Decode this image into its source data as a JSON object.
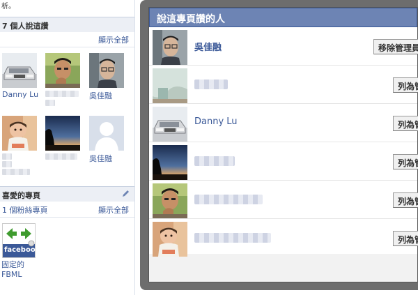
{
  "sidebar": {
    "top_text": "析。",
    "likes_section": {
      "title": "7 個人說這讚",
      "show_all": "顯示全部",
      "friends": [
        {
          "name": "Danny Lu",
          "photo": "car"
        },
        {
          "name": "",
          "photo": "man-hand"
        },
        {
          "name": "吳佳融",
          "photo": "man-glasses"
        },
        {
          "name": "",
          "photo": "baby"
        },
        {
          "name": "",
          "photo": "silhouette-dusk"
        },
        {
          "name": "吳佳融",
          "photo": "default-avatar"
        }
      ]
    },
    "pages_section": {
      "title": "喜愛的專頁",
      "fan_count": "1 個粉絲專頁",
      "show_all": "顯示全部",
      "page": {
        "name_line1": "固定的",
        "name_line2": "FBML",
        "icon_label": "facebook"
      }
    }
  },
  "dialog": {
    "title": "說這專頁讚的人",
    "rows": [
      {
        "name": "吳佳融",
        "photo": "man-glasses",
        "button": "移除管理員"
      },
      {
        "name": "",
        "photo": "curtain",
        "button": "列為管理員"
      },
      {
        "name": "Danny Lu",
        "photo": "car",
        "button": "列為管理員"
      },
      {
        "name": "",
        "photo": "silhouette-dusk",
        "button": "列為管理員"
      },
      {
        "name": "",
        "photo": "man-hand",
        "button": "列為管理員"
      },
      {
        "name": "",
        "photo": "baby",
        "button": "列為管理員"
      }
    ]
  },
  "colors": {
    "link": "#3b5998",
    "dialog_title_bg": "#6d84b4",
    "section_header_bg": "#eceff5",
    "overlay_frame": "#6d6d6d"
  }
}
